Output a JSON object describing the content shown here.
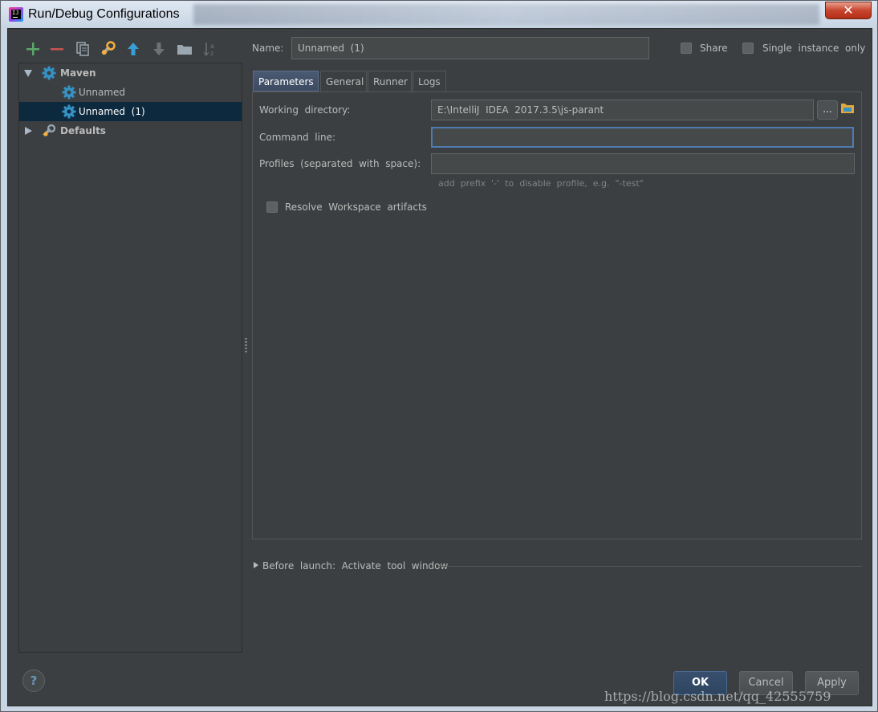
{
  "window": {
    "title": "Run/Debug Configurations",
    "close_label": "✕"
  },
  "toolbar": {
    "buttons": [
      "add",
      "remove",
      "copy",
      "edit-defaults",
      "move-up",
      "move-down",
      "folder",
      "sort"
    ]
  },
  "tree": {
    "maven": {
      "label": "Maven"
    },
    "items": [
      {
        "label": "Unnamed"
      },
      {
        "label": "Unnamed  (1)"
      }
    ],
    "defaults": {
      "label": "Defaults"
    }
  },
  "name_row": {
    "label": "Name:",
    "value": "Unnamed  (1)",
    "share_label": "Share",
    "single_instance_label": "Single  instance  only"
  },
  "tabs": [
    {
      "label": "Parameters"
    },
    {
      "label": "General"
    },
    {
      "label": "Runner"
    },
    {
      "label": "Logs"
    }
  ],
  "parameters": {
    "working_dir_label": "Working  directory:",
    "working_dir_value": "E:\\IntelliJ  IDEA  2017.3.5\\js-parant",
    "command_line_label": "Command  line:",
    "command_line_value": "",
    "profiles_label": "Profiles  (separated  with  space):",
    "profiles_value": "",
    "profiles_hint": "add  prefix  '-'  to  disable  profile,  e.g.  \"-test\"",
    "resolve_label": "Resolve  Workspace  artifacts",
    "browse_label": "..."
  },
  "before_launch": {
    "label": "Before  launch:  Activate  tool  window"
  },
  "footer": {
    "help": "?",
    "ok": "OK",
    "cancel": "Cancel",
    "apply": "Apply"
  },
  "watermark": "https://blog.csdn.net/qq_42555759",
  "colors": {
    "panel_bg": "#3c3f41",
    "selection": "#0d293e",
    "text": "#bbbbbb",
    "accent": "#4f7bb1"
  }
}
